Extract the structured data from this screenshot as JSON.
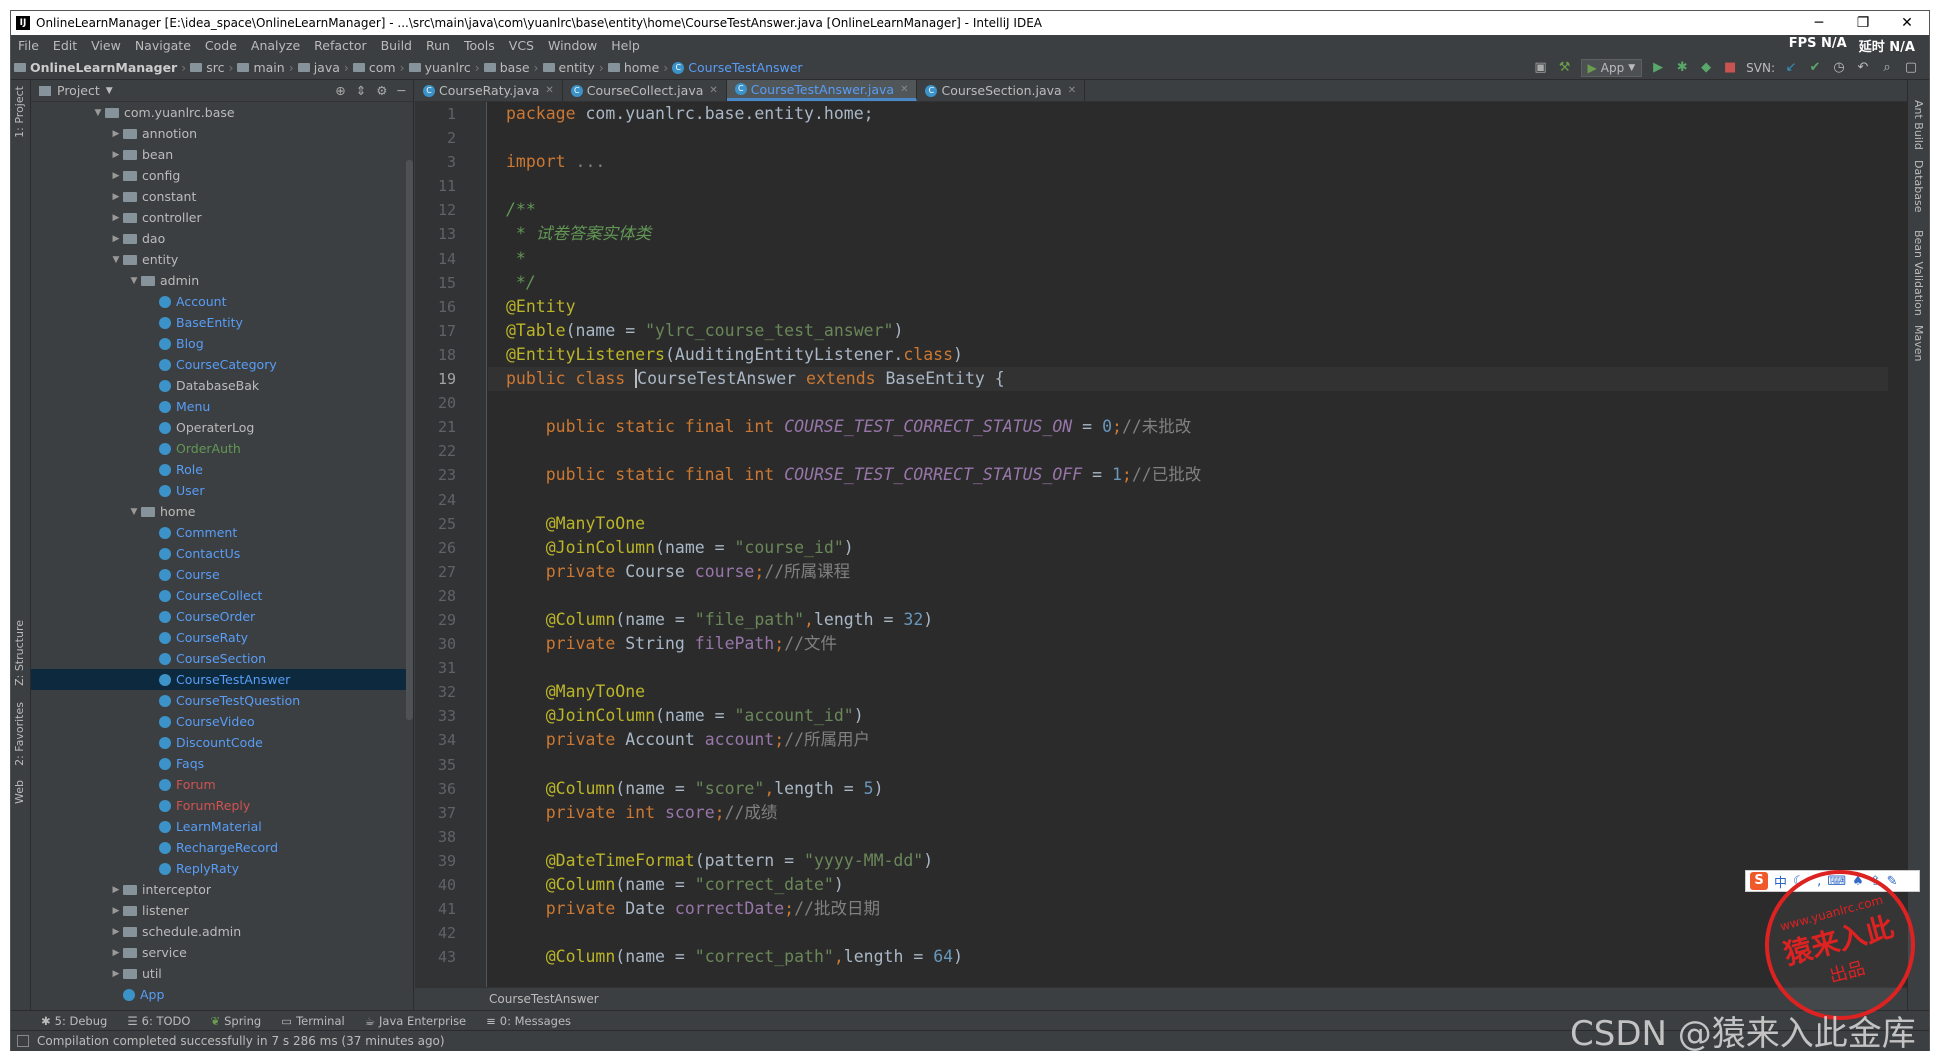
{
  "window": {
    "title": "OnlineLearnManager [E:\\idea_space\\OnlineLearnManager] - ...\\src\\main\\java\\com\\yuanlrc\\base\\entity\\home\\CourseTestAnswer.java [OnlineLearnManager] - IntelliJ IDEA",
    "minimize": "─",
    "maximize": "❐",
    "close": "✕"
  },
  "menu": {
    "items": [
      "File",
      "Edit",
      "View",
      "Navigate",
      "Code",
      "Analyze",
      "Refactor",
      "Build",
      "Run",
      "Tools",
      "VCS",
      "Window",
      "Help"
    ],
    "fps_label": "FPS",
    "fps_value": "N/A",
    "latency_label": "延时",
    "latency_value": "N/A"
  },
  "breadcrumb": {
    "project": "OnlineLearnManager",
    "items": [
      "src",
      "main",
      "java",
      "com",
      "yuanlrc",
      "base",
      "entity",
      "home"
    ],
    "class": "CourseTestAnswer"
  },
  "toolbar": {
    "run_config": "App",
    "svn_label": "SVN:"
  },
  "left_strip": {
    "project_tab": "1: Project",
    "structure_tab": "Z: Structure",
    "favorites_tab": "2: Favorites",
    "web_tab": "Web"
  },
  "right_strip": {
    "ant": "Ant Build",
    "database": "Database",
    "bean": "Bean Validation",
    "maven": "Maven"
  },
  "project_panel": {
    "title": "Project",
    "tree": [
      {
        "label": "com.yuanlrc.base",
        "indent": 0,
        "type": "pkg",
        "open": true
      },
      {
        "label": "annotion",
        "indent": 1,
        "type": "pkg"
      },
      {
        "label": "bean",
        "indent": 1,
        "type": "pkg"
      },
      {
        "label": "config",
        "indent": 1,
        "type": "pkg"
      },
      {
        "label": "constant",
        "indent": 1,
        "type": "pkg"
      },
      {
        "label": "controller",
        "indent": 1,
        "type": "pkg"
      },
      {
        "label": "dao",
        "indent": 1,
        "type": "pkg"
      },
      {
        "label": "entity",
        "indent": 1,
        "type": "pkg",
        "open": true
      },
      {
        "label": "admin",
        "indent": 2,
        "type": "pkg",
        "open": true
      },
      {
        "label": "Account",
        "indent": 3,
        "type": "cls"
      },
      {
        "label": "BaseEntity",
        "indent": 3,
        "type": "cls"
      },
      {
        "label": "Blog",
        "indent": 3,
        "type": "cls"
      },
      {
        "label": "CourseCategory",
        "indent": 3,
        "type": "cls"
      },
      {
        "label": "DatabaseBak",
        "indent": 3,
        "type": "plain"
      },
      {
        "label": "Menu",
        "indent": 3,
        "type": "cls"
      },
      {
        "label": "OperaterLog",
        "indent": 3,
        "type": "plain"
      },
      {
        "label": "OrderAuth",
        "indent": 3,
        "type": "green"
      },
      {
        "label": "Role",
        "indent": 3,
        "type": "cls"
      },
      {
        "label": "User",
        "indent": 3,
        "type": "cls"
      },
      {
        "label": "home",
        "indent": 2,
        "type": "pkg",
        "open": true
      },
      {
        "label": "Comment",
        "indent": 3,
        "type": "cls"
      },
      {
        "label": "ContactUs",
        "indent": 3,
        "type": "cls"
      },
      {
        "label": "Course",
        "indent": 3,
        "type": "cls"
      },
      {
        "label": "CourseCollect",
        "indent": 3,
        "type": "cls"
      },
      {
        "label": "CourseOrder",
        "indent": 3,
        "type": "cls"
      },
      {
        "label": "CourseRaty",
        "indent": 3,
        "type": "cls"
      },
      {
        "label": "CourseSection",
        "indent": 3,
        "type": "cls"
      },
      {
        "label": "CourseTestAnswer",
        "indent": 3,
        "type": "cls",
        "selected": true
      },
      {
        "label": "CourseTestQuestion",
        "indent": 3,
        "type": "cls"
      },
      {
        "label": "CourseVideo",
        "indent": 3,
        "type": "cls"
      },
      {
        "label": "DiscountCode",
        "indent": 3,
        "type": "cls"
      },
      {
        "label": "Faqs",
        "indent": 3,
        "type": "cls"
      },
      {
        "label": "Forum",
        "indent": 3,
        "type": "red"
      },
      {
        "label": "ForumReply",
        "indent": 3,
        "type": "red"
      },
      {
        "label": "LearnMaterial",
        "indent": 3,
        "type": "cls"
      },
      {
        "label": "RechargeRecord",
        "indent": 3,
        "type": "cls"
      },
      {
        "label": "ReplyRaty",
        "indent": 3,
        "type": "cls"
      },
      {
        "label": "interceptor",
        "indent": 1,
        "type": "pkg"
      },
      {
        "label": "listener",
        "indent": 1,
        "type": "pkg"
      },
      {
        "label": "schedule.admin",
        "indent": 1,
        "type": "pkg"
      },
      {
        "label": "service",
        "indent": 1,
        "type": "pkg"
      },
      {
        "label": "util",
        "indent": 1,
        "type": "pkg"
      },
      {
        "label": "App",
        "indent": 1,
        "type": "cls"
      }
    ]
  },
  "editor": {
    "tabs": [
      {
        "label": "CourseRaty.java",
        "active": false
      },
      {
        "label": "CourseCollect.java",
        "active": false
      },
      {
        "label": "CourseTestAnswer.java",
        "active": true
      },
      {
        "label": "CourseSection.java",
        "active": false
      }
    ],
    "current_line": "19",
    "breadcrumb": "CourseTestAnswer",
    "lines": [
      {
        "n": "1",
        "t": [
          [
            "kw",
            "package "
          ],
          [
            "",
            "com.yuanlrc.base.entity.home;"
          ]
        ]
      },
      {
        "n": "2",
        "t": []
      },
      {
        "n": "3",
        "t": [
          [
            "kw",
            "import "
          ],
          [
            "cmt",
            "..."
          ]
        ]
      },
      {
        "n": "11",
        "t": []
      },
      {
        "n": "12",
        "t": [
          [
            "doc",
            "/**"
          ]
        ]
      },
      {
        "n": "13",
        "t": [
          [
            "doc",
            " * 试卷答案实体类"
          ]
        ]
      },
      {
        "n": "14",
        "t": [
          [
            "doc",
            " *"
          ]
        ]
      },
      {
        "n": "15",
        "t": [
          [
            "doc",
            " */"
          ]
        ]
      },
      {
        "n": "16",
        "t": [
          [
            "ann",
            "@Entity"
          ]
        ]
      },
      {
        "n": "17",
        "t": [
          [
            "ann",
            "@Table"
          ],
          [
            "",
            "(name = "
          ],
          [
            "str",
            "\"ylrc_course_test_answer\""
          ],
          [
            "",
            ")"
          ]
        ]
      },
      {
        "n": "18",
        "t": [
          [
            "ann",
            "@EntityListeners"
          ],
          [
            "",
            "(AuditingEntityListener."
          ],
          [
            "kw",
            "class"
          ],
          [
            "",
            ")"
          ]
        ]
      },
      {
        "n": "19",
        "t": [
          [
            "kw",
            "public class "
          ],
          [
            "caret",
            "CourseTestAnswer"
          ],
          [
            "kw",
            " extends "
          ],
          [
            "",
            "BaseEntity {"
          ]
        ]
      },
      {
        "n": "20",
        "t": []
      },
      {
        "n": "21",
        "t": [
          [
            "kw",
            "    public static final int "
          ],
          [
            "cst",
            "COURSE_TEST_CORRECT_STATUS_ON"
          ],
          [
            "",
            " = "
          ],
          [
            "num",
            "0"
          ],
          [
            "kw",
            ";"
          ],
          [
            "cmt",
            "//未批改"
          ]
        ]
      },
      {
        "n": "22",
        "t": []
      },
      {
        "n": "23",
        "t": [
          [
            "kw",
            "    public static final int "
          ],
          [
            "cst",
            "COURSE_TEST_CORRECT_STATUS_OFF"
          ],
          [
            "",
            " = "
          ],
          [
            "num",
            "1"
          ],
          [
            "kw",
            ";"
          ],
          [
            "cmt",
            "//已批改"
          ]
        ]
      },
      {
        "n": "24",
        "t": []
      },
      {
        "n": "25",
        "t": [
          [
            "ann",
            "    @ManyToOne"
          ]
        ]
      },
      {
        "n": "26",
        "t": [
          [
            "ann",
            "    @JoinColumn"
          ],
          [
            "",
            "(name = "
          ],
          [
            "str",
            "\"course_id\""
          ],
          [
            "",
            ")"
          ]
        ]
      },
      {
        "n": "27",
        "t": [
          [
            "kw",
            "    private "
          ],
          [
            "",
            "Course "
          ],
          [
            "fld",
            "course"
          ],
          [
            "kw",
            ";"
          ],
          [
            "cmt",
            "//所属课程"
          ]
        ]
      },
      {
        "n": "28",
        "t": []
      },
      {
        "n": "29",
        "t": [
          [
            "ann",
            "    @Column"
          ],
          [
            "",
            "(name = "
          ],
          [
            "str",
            "\"file_path\""
          ],
          [
            "kw",
            ","
          ],
          [
            "",
            "length = "
          ],
          [
            "num",
            "32"
          ],
          [
            "",
            ")"
          ]
        ]
      },
      {
        "n": "30",
        "t": [
          [
            "kw",
            "    private "
          ],
          [
            "",
            "String "
          ],
          [
            "fld",
            "filePath"
          ],
          [
            "kw",
            ";"
          ],
          [
            "cmt",
            "//文件"
          ]
        ]
      },
      {
        "n": "31",
        "t": []
      },
      {
        "n": "32",
        "t": [
          [
            "ann",
            "    @ManyToOne"
          ]
        ]
      },
      {
        "n": "33",
        "t": [
          [
            "ann",
            "    @JoinColumn"
          ],
          [
            "",
            "(name = "
          ],
          [
            "str",
            "\"account_id\""
          ],
          [
            "",
            ")"
          ]
        ]
      },
      {
        "n": "34",
        "t": [
          [
            "kw",
            "    private "
          ],
          [
            "",
            "Account "
          ],
          [
            "fld",
            "account"
          ],
          [
            "kw",
            ";"
          ],
          [
            "cmt",
            "//所属用户"
          ]
        ]
      },
      {
        "n": "35",
        "t": []
      },
      {
        "n": "36",
        "t": [
          [
            "ann",
            "    @Column"
          ],
          [
            "",
            "(name = "
          ],
          [
            "str",
            "\"score\""
          ],
          [
            "kw",
            ","
          ],
          [
            "",
            "length = "
          ],
          [
            "num",
            "5"
          ],
          [
            "",
            ")"
          ]
        ]
      },
      {
        "n": "37",
        "t": [
          [
            "kw",
            "    private int "
          ],
          [
            "fld",
            "score"
          ],
          [
            "kw",
            ";"
          ],
          [
            "cmt",
            "//成绩"
          ]
        ]
      },
      {
        "n": "38",
        "t": []
      },
      {
        "n": "39",
        "t": [
          [
            "ann",
            "    @DateTimeFormat"
          ],
          [
            "",
            "(pattern = "
          ],
          [
            "str",
            "\"yyyy-MM-dd\""
          ],
          [
            "",
            ")"
          ]
        ]
      },
      {
        "n": "40",
        "t": [
          [
            "ann",
            "    @Column"
          ],
          [
            "",
            "(name = "
          ],
          [
            "str",
            "\"correct_date\""
          ],
          [
            "",
            ")"
          ]
        ]
      },
      {
        "n": "41",
        "t": [
          [
            "kw",
            "    private "
          ],
          [
            "",
            "Date "
          ],
          [
            "fld",
            "correctDate"
          ],
          [
            "kw",
            ";"
          ],
          [
            "cmt",
            "//批改日期"
          ]
        ]
      },
      {
        "n": "42",
        "t": []
      },
      {
        "n": "43",
        "t": [
          [
            "ann",
            "    @Column"
          ],
          [
            "",
            "(name = "
          ],
          [
            "str",
            "\"correct_path\""
          ],
          [
            "kw",
            ","
          ],
          [
            "",
            "length = "
          ],
          [
            "num",
            "64"
          ],
          [
            "",
            ")"
          ]
        ]
      }
    ]
  },
  "bottom_tabs": [
    "5: Debug",
    "6: TODO",
    "Spring",
    "Terminal",
    "Java Enterprise",
    "0: Messages"
  ],
  "status": {
    "message": "Compilation completed successfully in 7 s 286 ms (37 minutes ago)"
  },
  "ime_bar": {
    "logo": "S",
    "lang": "中"
  },
  "stamp": {
    "line1": "猿来入此",
    "line2": "www.yuanlrc.com",
    "line3": "出品"
  },
  "watermark": "CSDN @猿来入此金库",
  "colors": {
    "bg_editor": "#2b2b2b",
    "bg_panel": "#3c3f41",
    "keyword": "#cc7832",
    "annotation": "#bbb529",
    "string": "#6a8759",
    "number": "#6897bb",
    "comment": "#808080",
    "class_blue": "#589df6"
  }
}
